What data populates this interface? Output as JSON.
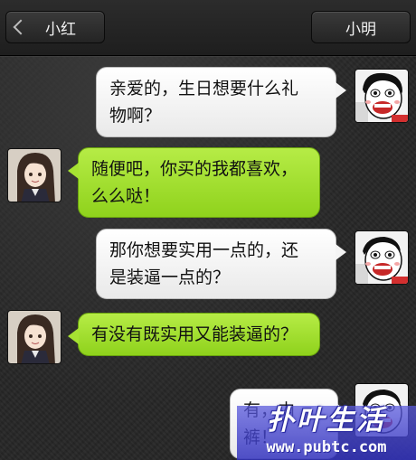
{
  "header": {
    "back_label": "小红",
    "profile_label": "小明"
  },
  "messages": [
    {
      "sender": "me",
      "line1": "亲爱的，生日想要什么礼",
      "line2": "物啊？"
    },
    {
      "sender": "her",
      "line1": "随便吧，你买的我都喜欢，",
      "line2": "么么哒！"
    },
    {
      "sender": "me",
      "line1": "那你想要实用一点的，还",
      "line2": "是装逼一点的？"
    },
    {
      "sender": "her",
      "line1": "有没有既实用又能装逼的？"
    },
    {
      "sender": "me",
      "line1": "有，内裤！"
    }
  ],
  "watermark": {
    "logo": "扑叶生活",
    "url": "www.pubtc.com"
  },
  "colors": {
    "background": "#262626",
    "her_bubble": "#9ddc2a",
    "me_bubble": "#f4f4f4",
    "watermark": "#3c3cc8"
  },
  "icons": {
    "back": "chevron-left-icon",
    "me_avatar": "cartoon-man-avatar",
    "her_avatar": "anime-girl-avatar"
  }
}
